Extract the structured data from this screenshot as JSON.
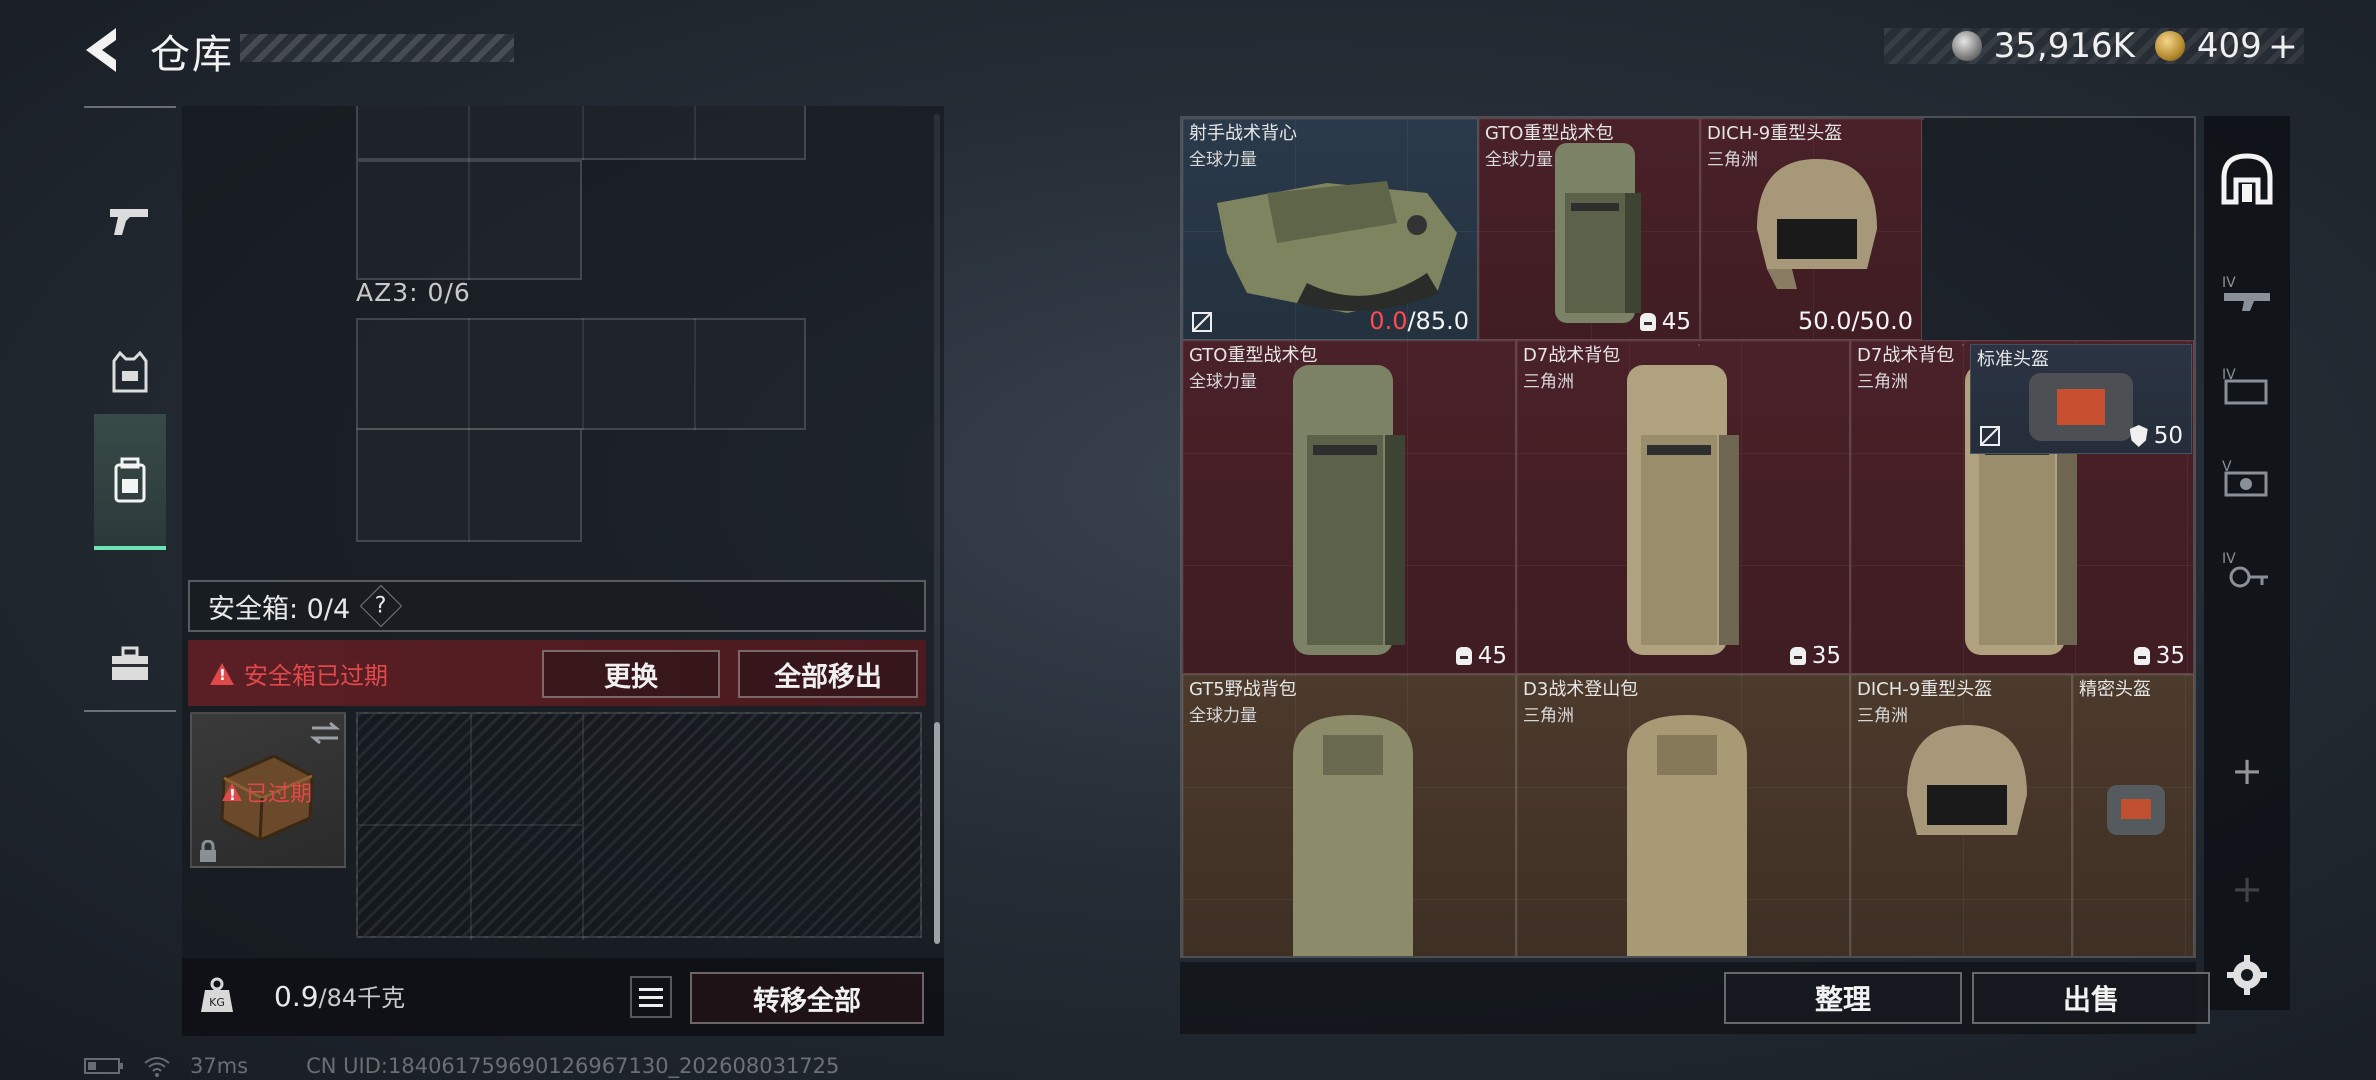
{
  "header": {
    "title": "仓库",
    "currency_silver": "35,916K",
    "currency_gold": "409",
    "currency_add": "+"
  },
  "left_tabs": [
    "weapon-tab",
    "gear-tab",
    "backpack-tab",
    "toolbox-tab"
  ],
  "container": {
    "az3_label": "AZ3: 0/6",
    "safe_box_label": "安全箱: 0/4",
    "help_label": "?",
    "expired_warning": "安全箱已过期",
    "replace_button": "更换",
    "move_all_out_button": "全部移出",
    "case_expired_label": "已过期"
  },
  "weight": {
    "current": "0.9",
    "max": "/84千克",
    "transfer_all_button": "转移全部"
  },
  "stash_items": [
    {
      "name": "射手战术背心",
      "sub": "全球力量",
      "dur_current": "0.0",
      "dur_max": "/85.0"
    },
    {
      "name": "GTO重型战术包",
      "sub": "全球力量",
      "capacity": "45"
    },
    {
      "name": "DICH-9重型头盔",
      "sub": "三角洲",
      "durability": "50.0/50.0"
    },
    {
      "name": "标准头盔",
      "sub": "",
      "armor": "50"
    },
    {
      "name": "GTO重型战术包",
      "sub": "全球力量",
      "capacity": "45"
    },
    {
      "name": "D7战术背包",
      "sub": "三角洲",
      "capacity": "35"
    },
    {
      "name": "D7战术背包",
      "sub": "三角洲",
      "capacity": "35"
    },
    {
      "name": "GT5野战背包",
      "sub": "全球力量"
    },
    {
      "name": "D3战术登山包",
      "sub": "三角洲"
    },
    {
      "name": "DICH-9重型头盔",
      "sub": "三角洲"
    },
    {
      "name": "精密头盔",
      "sub": ""
    }
  ],
  "actions": {
    "organize": "整理",
    "sell": "出售"
  },
  "status": {
    "ping": "37ms",
    "uid": "CN UID:18406175969012696713​0_202608031725"
  },
  "colors": {
    "accent_green": "#6fe3b5",
    "warning_red": "#e0484a",
    "durability_red": "#ff4b4b"
  }
}
